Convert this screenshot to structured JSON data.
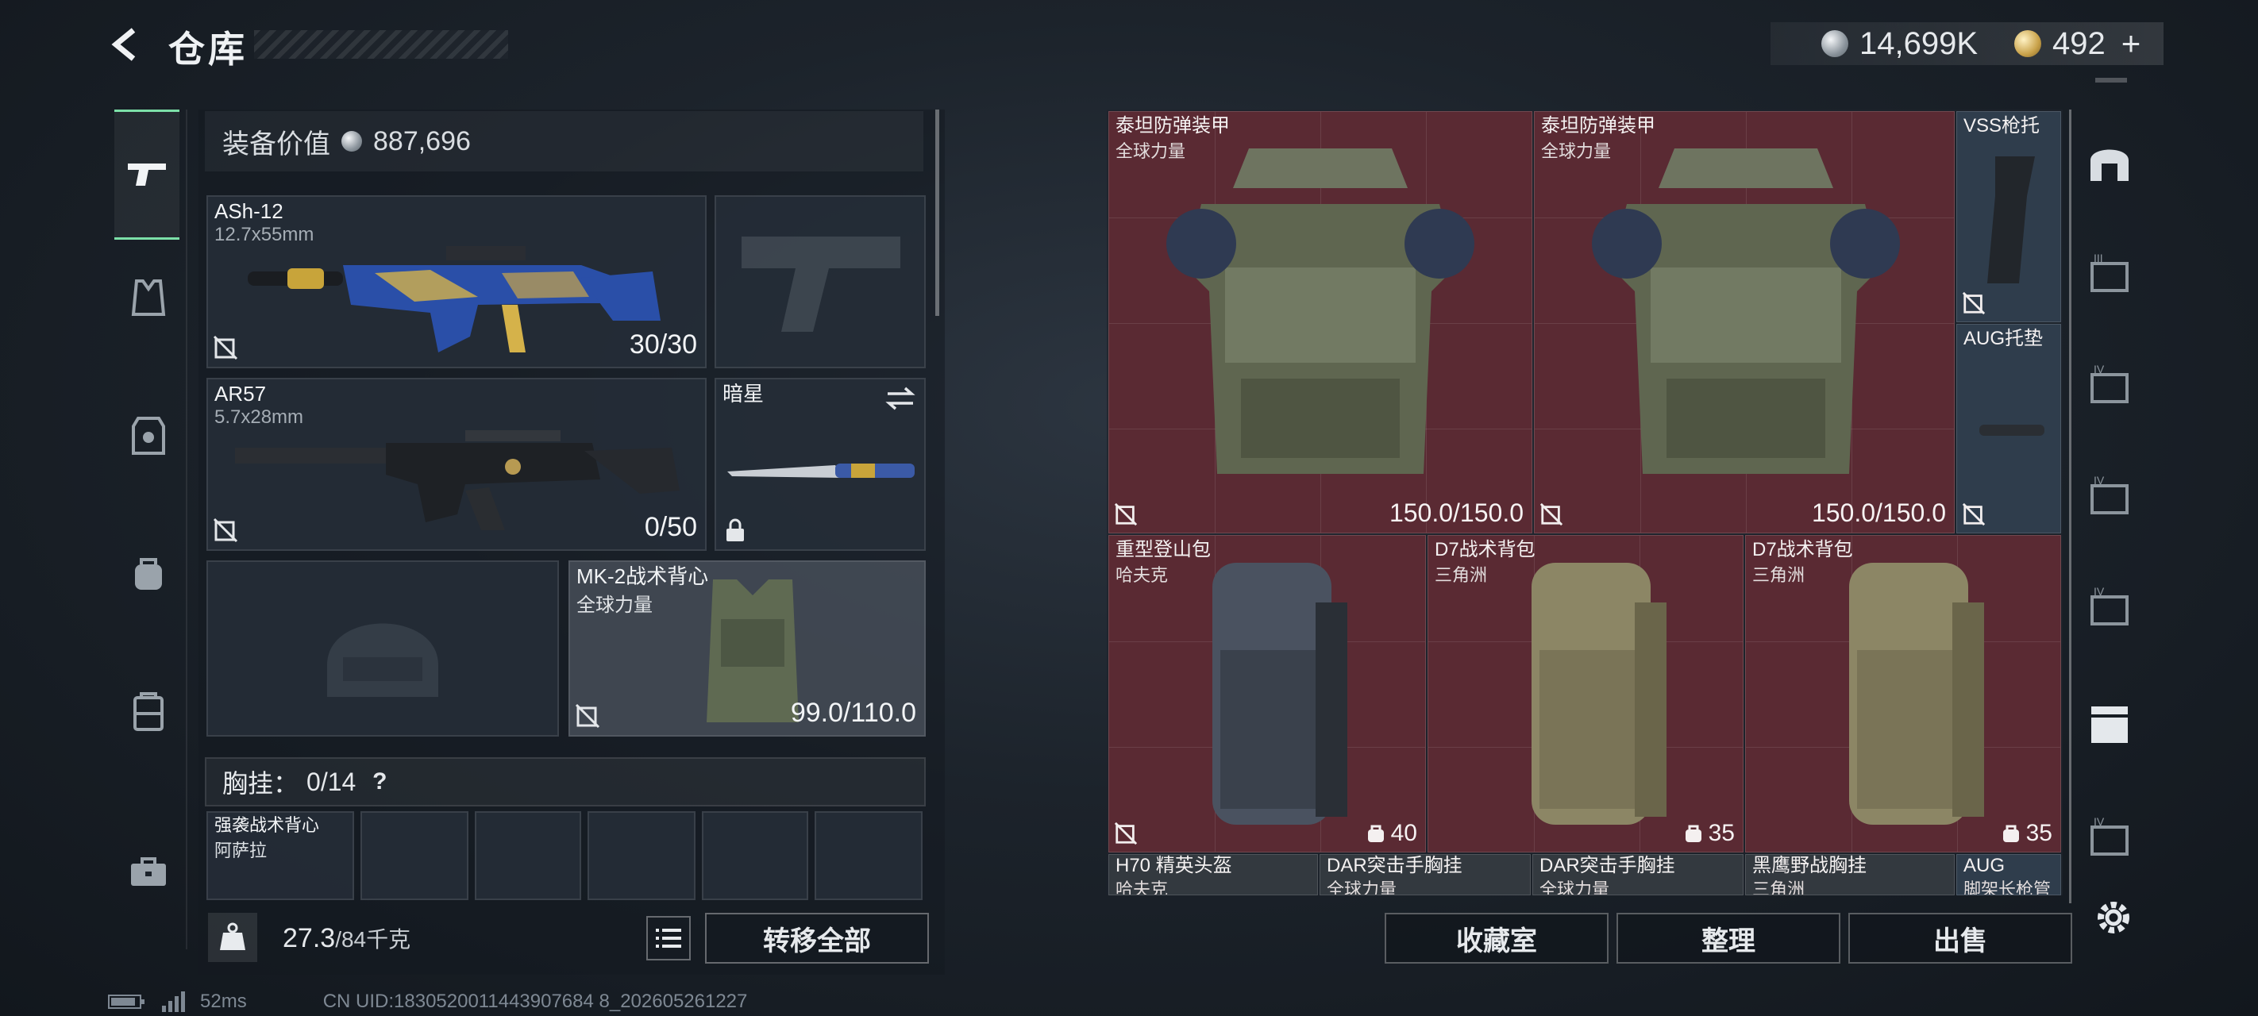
{
  "header": {
    "title": "仓库",
    "currency": {
      "silver": "14,699K",
      "gold": "492"
    }
  },
  "loadout": {
    "value_label": "装备价值",
    "value": "887,696",
    "primary": {
      "name": "ASh-12",
      "ammo": "12.7x55mm",
      "count": "30/30"
    },
    "secondary": {
      "name": "AR57",
      "ammo": "5.7x28mm",
      "count": "0/50"
    },
    "melee": {
      "name": "暗星"
    },
    "armor": {
      "name": "MK-2战术背心",
      "sub": "全球力量",
      "durability": "99.0/110.0"
    },
    "chest_rig": {
      "label": "胸挂：",
      "value": "0/14",
      "help": "?"
    },
    "rig_item": {
      "name": "强袭战术背心",
      "sub": "阿萨拉"
    },
    "weight": {
      "current": "27.3",
      "max": "/84千克"
    },
    "transfer_all": "转移全部"
  },
  "storage": {
    "items": [
      {
        "name": "泰坦防弹装甲",
        "sub": "全球力量",
        "value": "150.0/150.0"
      },
      {
        "name": "泰坦防弹装甲",
        "sub": "全球力量",
        "value": "150.0/150.0"
      },
      {
        "name": "VSS枪托",
        "sub": ""
      },
      {
        "name": "AUG托垫",
        "sub": ""
      },
      {
        "name": "重型登山包",
        "sub": "哈夫克",
        "value": "40"
      },
      {
        "name": "D7战术背包",
        "sub": "三角洲",
        "value": "35"
      },
      {
        "name": "D7战术背包",
        "sub": "三角洲",
        "value": "35"
      },
      {
        "name": "H70 精英头盔",
        "sub": "哈夫克"
      },
      {
        "name": "DAR突击手胸挂",
        "sub": "全球力量"
      },
      {
        "name": "DAR突击手胸挂",
        "sub": "全球力量"
      },
      {
        "name": "黑鹰野战胸挂",
        "sub": "三角洲"
      },
      {
        "name": "AUG",
        "sub": "脚架长枪管"
      }
    ],
    "actions": [
      "收藏室",
      "整理",
      "出售"
    ]
  },
  "status": {
    "ping": "52ms",
    "uid": "CN UID:1830520011443907684 8_202605261227"
  },
  "colors": {
    "accent": "#7ce0a8",
    "storage_red": "#5a2a33",
    "storage_blue": "#2f3d4c"
  }
}
